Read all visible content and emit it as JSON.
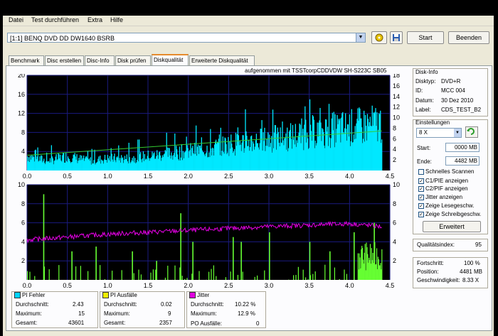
{
  "menu": [
    "Datei",
    "Test durchführen",
    "Extra",
    "Hilfe"
  ],
  "toolbar": {
    "drive": "[1:1] BENQ DVD DD DW1640 BSRB",
    "start_label": "Start",
    "close_label": "Beenden"
  },
  "tabs": [
    "Benchmark",
    "Disc erstellen",
    "Disc-Info",
    "Disk prüfen",
    "Diskqualität",
    "Erweiterte Diskqualität"
  ],
  "active_tab": 4,
  "top_chart": {
    "title": "aufgenommen mit TSSTcorpCDDVDW SH-S223C  SB05",
    "left_ticks": [
      "20",
      "16",
      "12",
      "8",
      "4"
    ],
    "right_ticks": [
      "18",
      "16",
      "14",
      "12",
      "10",
      "8",
      "6",
      "4",
      "2"
    ],
    "x_ticks": [
      "0.0",
      "0.5",
      "1.0",
      "1.5",
      "2.0",
      "2.5",
      "3.0",
      "3.5",
      "4.0",
      "4.5"
    ]
  },
  "bottom_chart": {
    "left_ticks": [
      "10",
      "8",
      "6",
      "4",
      "2"
    ],
    "right_ticks": [
      "10",
      "8",
      "6",
      "4",
      "2"
    ],
    "x_ticks": [
      "0.0",
      "0.5",
      "1.0",
      "1.5",
      "2.0",
      "2.5",
      "3.0",
      "3.5",
      "4.0",
      "4.5"
    ]
  },
  "disc_info": {
    "title": "Disk-Info",
    "rows": [
      {
        "label": "Disktyp:",
        "value": "DVD+R"
      },
      {
        "label": "ID:",
        "value": "MCC 004"
      },
      {
        "label": "Datum:",
        "value": "30 Dez 2010"
      },
      {
        "label": "Label:",
        "value": "CDS_TEST_B2"
      }
    ]
  },
  "settings": {
    "title": "Einstellungen",
    "speed": "8 X",
    "start_label": "Start:",
    "start_value": "0000 MB",
    "end_label": "Ende:",
    "end_value": "4482 MB",
    "checkboxes": [
      {
        "label": "Schnelles Scannen",
        "checked": false
      },
      {
        "label": "C1/PIE anzeigen",
        "checked": true
      },
      {
        "label": "C2/PIF anzeigen",
        "checked": true
      },
      {
        "label": "Jitter anzeigen",
        "checked": true
      },
      {
        "label": "Zeige Lesegeschw.",
        "checked": true
      },
      {
        "label": "Zeige Schreibgeschw.",
        "checked": true
      }
    ],
    "advanced_label": "Erweitert"
  },
  "quality": {
    "label": "Qualitätsindex:",
    "value": "95"
  },
  "progress": {
    "rows": [
      {
        "label": "Fortschritt:",
        "value": "100 %"
      },
      {
        "label": "Position:",
        "value": "4481 MB"
      },
      {
        "label": "Geschwindigkeit:",
        "value": "8.33 X"
      }
    ]
  },
  "stats": {
    "pi_errors": {
      "title": "PI Fehler",
      "color": "#00d4ff",
      "rows": [
        {
          "label": "Durchschnitt:",
          "value": "2.43"
        },
        {
          "label": "Maximum:",
          "value": "15"
        },
        {
          "label": "Gesamt:",
          "value": "43601"
        }
      ]
    },
    "pi_failures": {
      "title": "PI Ausfälle",
      "color": "#f0f000",
      "rows": [
        {
          "label": "Durchschnitt:",
          "value": "0.02"
        },
        {
          "label": "Maximum:",
          "value": "9"
        },
        {
          "label": "Gesamt:",
          "value": "2357"
        }
      ]
    },
    "jitter": {
      "title": "Jitter",
      "color": "#e000e0",
      "rows": [
        {
          "label": "Durchschnitt:",
          "value": "10.22 %"
        },
        {
          "label": "Maximum:",
          "value": "12.9 %"
        }
      ],
      "po_label": "PO Ausfälle:",
      "po_value": "0"
    }
  },
  "colors": {
    "pi_fill": "#00e8ff",
    "pi_failures_fill": "#66ff33",
    "jitter_line": "#e000e0",
    "speed_line": "#33cc33",
    "chart_bg": "#000000",
    "grid": "#1a1a80"
  },
  "chart_data": [
    {
      "type": "area",
      "xlabel": "",
      "ylabel": "",
      "xlim": [
        0,
        4.5
      ],
      "ylim": [
        0,
        20
      ],
      "series": [
        {
          "name": "PI Fehler",
          "x": [
            0.0,
            0.25,
            0.5,
            0.75,
            1.0,
            1.25,
            1.5,
            1.75,
            2.0,
            2.25,
            2.5,
            2.75,
            3.0,
            3.25,
            3.5,
            3.75,
            4.0,
            4.25,
            4.4
          ],
          "values": [
            3,
            2,
            3,
            2,
            2.5,
            2.5,
            3,
            3.5,
            4,
            4.5,
            5.5,
            6,
            6.5,
            7,
            8,
            8.5,
            9,
            9.5,
            10
          ]
        },
        {
          "name": "Lesegeschwindigkeit",
          "x": [
            0.0,
            4.4
          ],
          "values": [
            3.2,
            8.3
          ]
        }
      ]
    },
    {
      "type": "bar",
      "xlabel": "",
      "ylabel": "",
      "xlim": [
        0,
        4.5
      ],
      "ylim": [
        0,
        10
      ],
      "series": [
        {
          "name": "PI Ausfälle",
          "x": [
            0.2,
            0.55,
            0.85,
            1.3,
            1.6,
            1.9,
            2.05,
            2.55,
            2.65,
            3.0,
            3.5,
            3.75,
            4.05,
            4.3
          ],
          "values": [
            9,
            3,
            3.5,
            3,
            2,
            7,
            4,
            4.5,
            4,
            5,
            4,
            3,
            5,
            6
          ]
        },
        {
          "name": "Jitter",
          "x": [
            0.0,
            1.0,
            2.0,
            3.0,
            4.0,
            4.4
          ],
          "values": [
            4.2,
            4.8,
            5.2,
            5.6,
            5.9,
            5.6
          ]
        }
      ]
    }
  ]
}
